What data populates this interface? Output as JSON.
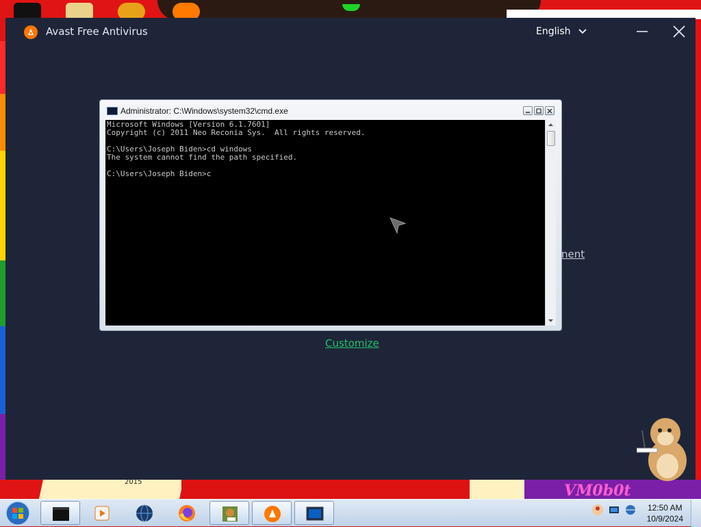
{
  "avast_window": {
    "title": "Avast Free Antivirus",
    "language": "English",
    "partial_link": "nent",
    "customize_link": "Customize",
    "accent_color": "#1fc26a",
    "background_color": "#1f2538"
  },
  "cmd_window": {
    "title": "Administrator: C:\\Windows\\system32\\cmd.exe",
    "lines": [
      "Microsoft Windows [Version 6.1.7601]",
      "Copyright (c) 2011 Neo Reconia Sys.  All rights reserved.",
      "",
      "C:\\Users\\Joseph Biden>cd windows",
      "The system cannot find the path specified.",
      "",
      "C:\\Users\\Joseph Biden>c"
    ]
  },
  "wallpaper": {
    "year_text": "2015",
    "vm_text": "VM0b0t"
  },
  "taskbar": {
    "items": [
      {
        "name": "cmd-window-button",
        "icon": "black-window-icon"
      },
      {
        "name": "media-player-button",
        "icon": "play-icon"
      },
      {
        "name": "dark-globe-button",
        "icon": "globe-icon"
      },
      {
        "name": "firefox-button",
        "icon": "firefox-icon"
      },
      {
        "name": "box-app-button",
        "icon": "box-icon"
      },
      {
        "name": "avast-button",
        "icon": "avast-icon"
      },
      {
        "name": "cmd-button",
        "icon": "monitor-icon"
      }
    ],
    "clock": {
      "time": "12:50 AM",
      "date": "10/9/2024"
    }
  }
}
